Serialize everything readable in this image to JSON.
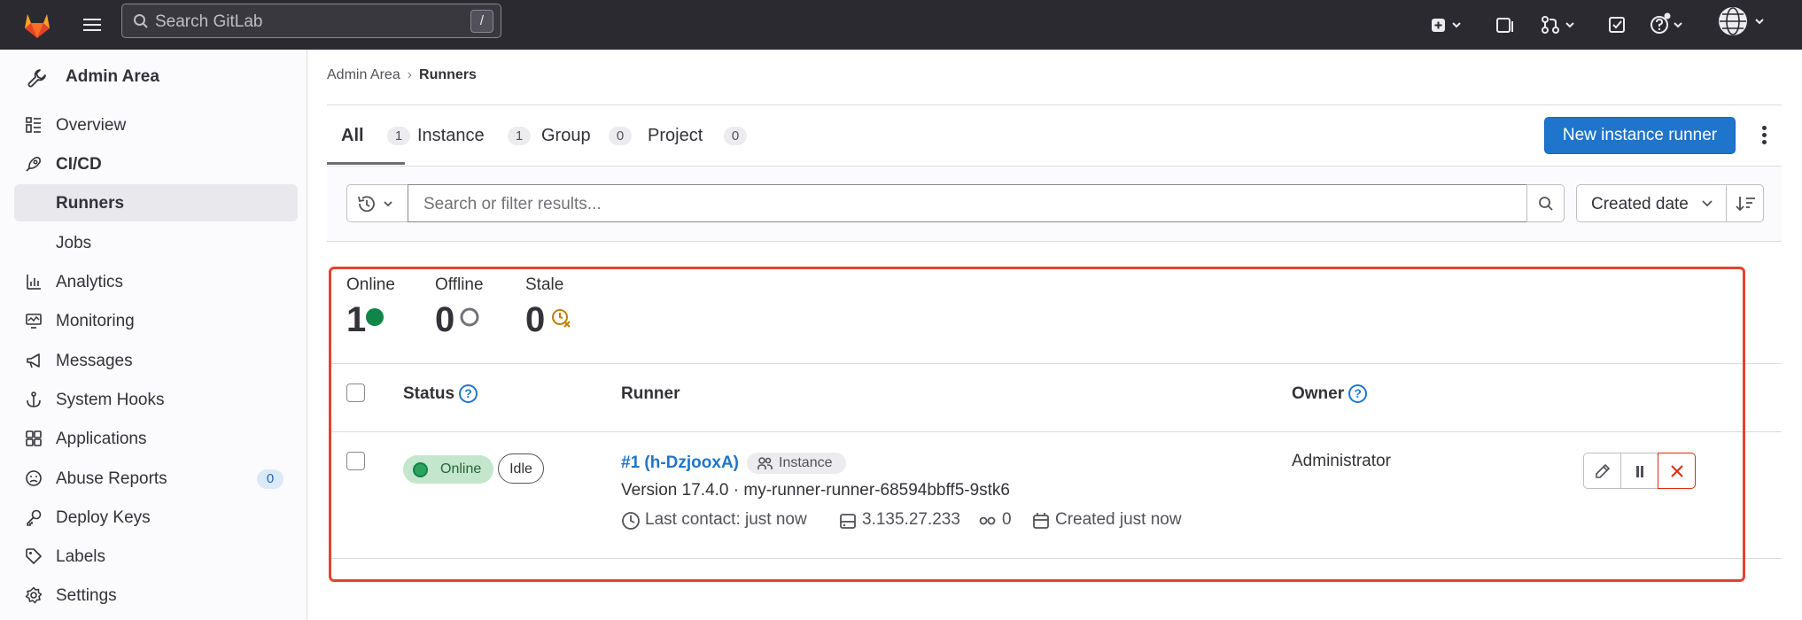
{
  "topbar": {
    "search_placeholder": "Search GitLab",
    "search_shortcut": "/",
    "icons": [
      "create-new-icon",
      "chevron-down-icon",
      "issues-icon",
      "merge-request-icon",
      "chevron-down-icon",
      "todo-icon",
      "help-icon",
      "chevron-down-icon",
      "avatar-icon",
      "chevron-down-icon"
    ]
  },
  "sidebar": {
    "header": "Admin Area",
    "items": [
      {
        "label": "Overview",
        "icon": "overview-icon"
      },
      {
        "label": "CI/CD",
        "icon": "rocket-icon"
      },
      {
        "label": "Runners",
        "icon": ""
      },
      {
        "label": "Jobs",
        "icon": ""
      },
      {
        "label": "Analytics",
        "icon": "chart-icon"
      },
      {
        "label": "Monitoring",
        "icon": "monitor-icon"
      },
      {
        "label": "Messages",
        "icon": "megaphone-icon"
      },
      {
        "label": "System Hooks",
        "icon": "anchor-icon"
      },
      {
        "label": "Applications",
        "icon": "applications-icon"
      },
      {
        "label": "Abuse Reports",
        "icon": "abuse-icon",
        "count": "0"
      },
      {
        "label": "Deploy Keys",
        "icon": "key-icon"
      },
      {
        "label": "Labels",
        "icon": "label-icon"
      },
      {
        "label": "Settings",
        "icon": "settings-icon"
      }
    ]
  },
  "breadcrumb": {
    "parent": "Admin Area",
    "separator": "›",
    "current": "Runners"
  },
  "tabs": [
    {
      "label": "All",
      "count": "1"
    },
    {
      "label": "Instance",
      "count": "1"
    },
    {
      "label": "Group",
      "count": "0"
    },
    {
      "label": "Project",
      "count": "0"
    }
  ],
  "actions": {
    "new_runner": "New instance runner"
  },
  "filter": {
    "placeholder": "Search or filter results...",
    "sort_label": "Created date"
  },
  "stats": {
    "online_label": "Online",
    "online_value": "1",
    "offline_label": "Offline",
    "offline_value": "0",
    "stale_label": "Stale",
    "stale_value": "0"
  },
  "table": {
    "headers": {
      "status": "Status",
      "runner": "Runner",
      "owner": "Owner"
    },
    "help_glyph": "?",
    "rows": [
      {
        "status": "Online",
        "state": "Idle",
        "name": "#1 (h-DzjooxA)",
        "type": "Instance",
        "version_line": "Version 17.4.0 · my-runner-runner-68594bbff5-9stk6",
        "last_contact": "Last contact: just now",
        "ip": "3.135.27.233",
        "jobs": "0",
        "created": "Created just now",
        "owner": "Administrator"
      }
    ]
  },
  "colors": {
    "topbar": "#2b2a30",
    "primary": "#1f75cb",
    "success": "#108548",
    "highlight": "#e5432c",
    "danger": "#dd2b0e"
  }
}
